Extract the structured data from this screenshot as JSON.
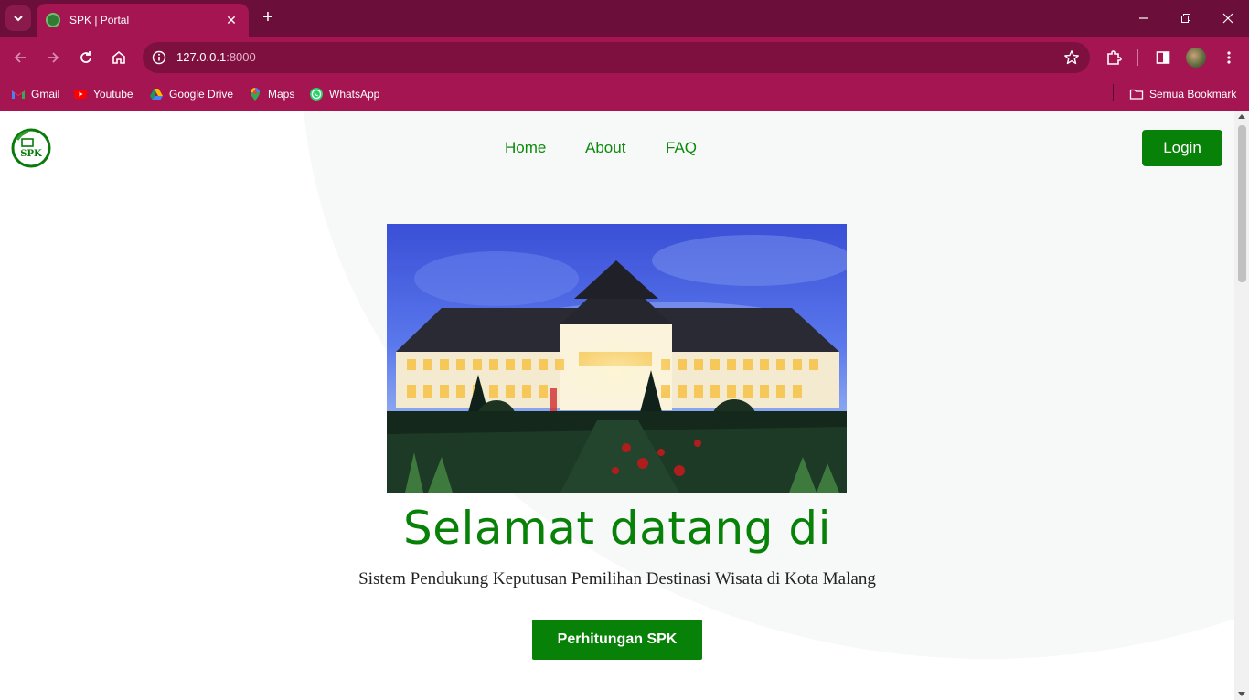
{
  "browser": {
    "tab_title": "SPK | Portal",
    "url_host": "127.0.0.1",
    "url_port": ":8000",
    "bookmarks": [
      {
        "label": "Gmail",
        "icon": "gmail-icon"
      },
      {
        "label": "Youtube",
        "icon": "youtube-icon"
      },
      {
        "label": "Google Drive",
        "icon": "google-drive-icon"
      },
      {
        "label": "Maps",
        "icon": "maps-icon"
      },
      {
        "label": "WhatsApp",
        "icon": "whatsapp-icon"
      }
    ],
    "all_bookmarks": "Semua Bookmark",
    "colors": {
      "tabstrip": "#6b0f3a",
      "toolbar": "#a51552"
    }
  },
  "page": {
    "nav": {
      "home": "Home",
      "about": "About",
      "faq": "FAQ"
    },
    "login": "Login",
    "hero": {
      "title": "Selamat datang di",
      "subtitle": "Sistem Pendukung Keputusan Pemilihan Destinasi Wisata di Kota Malang",
      "cta": "Perhitungan SPK"
    },
    "colors": {
      "primary": "#088108",
      "nav_link": "#0c8a0c"
    }
  }
}
